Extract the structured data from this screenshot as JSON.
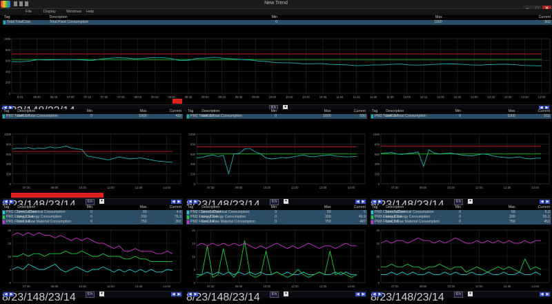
{
  "window": {
    "title": "New Trend",
    "menu": [
      "File",
      "Display",
      "Windows",
      "Help"
    ]
  },
  "headers": {
    "tag": "Tag",
    "desc": "Description",
    "min": "Min",
    "max": "Max",
    "cur": "Current"
  },
  "top": {
    "tag": "Total TotalCost",
    "desc": "Total Plant Consumption",
    "min": "0",
    "max": "1000",
    "cur": "502",
    "yticks": [
      "1000",
      "800",
      "600",
      "400",
      "200",
      "0"
    ],
    "xticks": [
      "6:15",
      "06:30",
      "06:45",
      "07:00",
      "07:15",
      "07:30",
      "07:45",
      "08:00",
      "08:15",
      "08:30",
      "08:45",
      "09:00",
      "09:15",
      "09:30",
      "09:45",
      "10:00",
      "10:15",
      "10:30",
      "10:45",
      "11:00",
      "11:15",
      "11:30",
      "11:45",
      "12:00",
      "12:15",
      "12:30",
      "12:45",
      "13:00",
      "13:15",
      "13:30",
      "13:45",
      "14:00"
    ],
    "date_left": "8/23/14",
    "date_right": "8/23/14",
    "interval": "8 h",
    "range": [
      0,
      1000
    ]
  },
  "mid": [
    {
      "tag": "PM1 TotalCost",
      "desc": "Line 1 Total Consumption",
      "min": "0",
      "max": "1000",
      "cur": "432",
      "yticks": [
        "1000",
        "800",
        "600",
        "400",
        "200",
        "0"
      ],
      "xticks": [
        "07:30",
        "09:00",
        "10:30",
        "12:00",
        "13:30",
        "14:00"
      ],
      "date_left": "8/23/14",
      "date_right": "8/23/14",
      "interval": "6 h",
      "range": [
        0,
        1000
      ]
    },
    {
      "tag": "PM2 TotalCost",
      "desc": "Line 2 Total Consumption",
      "min": "0",
      "max": "1000",
      "cur": "550",
      "yticks": [
        "1000",
        "800",
        "600",
        "400",
        "200",
        "0"
      ],
      "xticks": [
        "07:30",
        "09:00",
        "10:30",
        "12:00",
        "13:30",
        "14:00"
      ],
      "date_left": "8/23/14",
      "date_right": "8/23/14",
      "interval": "6 h",
      "range": [
        0,
        1000
      ]
    },
    {
      "tag": "PM3 TotalCost",
      "desc": "Line 3 Total Consumption",
      "min": "0",
      "max": "1000",
      "cur": "515",
      "yticks": [
        "1000",
        "800",
        "600",
        "400",
        "200",
        "0"
      ],
      "xticks": [
        "07:30",
        "09:00",
        "10:30",
        "12:00",
        "13:30",
        "14:00"
      ],
      "date_left": "8/23/14",
      "date_right": "8/23/14",
      "interval": "6 h",
      "range": [
        0,
        1000
      ]
    }
  ],
  "bottom": [
    {
      "rows": [
        {
          "tag": "PM1 ChemicalCost",
          "desc": "Line 1 Chemical Consumption",
          "min": "0",
          "max": "50",
          "cur": "4.6",
          "color": "#22cccc"
        },
        {
          "tag": "PM1 EnergyCost",
          "desc": "Line 1 Energy Consumption",
          "min": "0",
          "max": "200",
          "cur": "76.3",
          "color": "#22cc44"
        },
        {
          "tag": "PM1 FiberCost",
          "desc": "Line 1 Raw Material Consumption",
          "min": "0",
          "max": "750",
          "cur": "391",
          "color": "#cc33cc"
        }
      ],
      "yticks": [
        "20",
        "15",
        "10",
        "5",
        "0"
      ],
      "xticks": [
        "07:30",
        "09:00",
        "10:30",
        "12:00",
        "13:30",
        "14:00"
      ],
      "date_left": "8/23/14",
      "date_right": "8/23/14",
      "interval": "6 h"
    },
    {
      "rows": [
        {
          "tag": "PM2 ChemicalCost",
          "desc": "Line 2 Chemical Consumption",
          "min": "0",
          "max": "50",
          "cur": "5",
          "color": "#22cccc"
        },
        {
          "tag": "PM2 EnergyCost",
          "desc": "Line 2 Energy Consumption",
          "min": "0",
          "max": "200",
          "cur": "45.9",
          "color": "#22cc44"
        },
        {
          "tag": "PM2 FiberCost",
          "desc": "Line 2 Raw Material Consumption",
          "min": "0",
          "max": "750",
          "cur": "497",
          "color": "#cc33cc"
        }
      ],
      "yticks": [
        "20",
        "15",
        "10",
        "5",
        "0"
      ],
      "xticks": [
        "07:30",
        "09:00",
        "10:30",
        "12:00",
        "13:30",
        "14:00"
      ],
      "date_left": "8/23/14",
      "date_right": "8/23/14",
      "interval": "6 h"
    },
    {
      "rows": [
        {
          "tag": "PM3 ChemicalCost",
          "desc": "Line 3 Chemical Consumption",
          "min": "0",
          "max": "50",
          "cur": "6.3",
          "color": "#22cccc"
        },
        {
          "tag": "PM3 EnergyCost",
          "desc": "Line 3 Energy Consumption",
          "min": "0",
          "max": "200",
          "cur": "55.1",
          "color": "#22cc44"
        },
        {
          "tag": "PM3 FiberCost",
          "desc": "Line 3 Raw Material Consumption",
          "min": "0",
          "max": "750",
          "cur": "453",
          "color": "#cc33cc"
        }
      ],
      "yticks": [
        "20",
        "15",
        "10",
        "5",
        "0"
      ],
      "xticks": [
        "07:30",
        "09:00",
        "10:30",
        "12:00",
        "13:30",
        "14:00"
      ],
      "date_left": "8/23/14",
      "date_right": "8/23/14",
      "interval": "6 h"
    }
  ],
  "colors": {
    "trace": "#20b0b0",
    "limit_high": "#c82020",
    "limit_low": "#20c020",
    "alarm": "#e02020",
    "energy": "#22cc44",
    "fiber": "#cc33cc",
    "chem": "#22cccc"
  },
  "chart_data": [
    {
      "type": "line",
      "series": [
        {
          "name": "Total TotalCost",
          "values": [
            580,
            575,
            590,
            620,
            610,
            615,
            620,
            618,
            612,
            600,
            625,
            640,
            650,
            645,
            630,
            640,
            655,
            650,
            640,
            600,
            605,
            640,
            645,
            660,
            640,
            630,
            620,
            610,
            590,
            580,
            560,
            560,
            555,
            540,
            540,
            545,
            530,
            525,
            520,
            505,
            510,
            520,
            520,
            530,
            535,
            520,
            515,
            522,
            530,
            540,
            538,
            530,
            520,
            515,
            525,
            530,
            532,
            524,
            510,
            505,
            502
          ]
        }
      ],
      "ylim": [
        0,
        1000
      ],
      "limits": {
        "high": 720,
        "low": 620
      }
    },
    {
      "type": "line",
      "series": [
        {
          "name": "PM1 TotalCost",
          "values": [
            700,
            720,
            710,
            730,
            700,
            720,
            710,
            740,
            720,
            730,
            760,
            720,
            700,
            690,
            560,
            540,
            520,
            500,
            480,
            510,
            540,
            520,
            500,
            510,
            520,
            500,
            480,
            460,
            450,
            440,
            432
          ]
        }
      ],
      "ylim": [
        0,
        1000
      ],
      "limits": {
        "high": 650,
        "low": 0
      }
    },
    {
      "type": "line",
      "series": [
        {
          "name": "PM2 TotalCost",
          "values": [
            520,
            530,
            560,
            580,
            550,
            570,
            200,
            600,
            610,
            700,
            710,
            640,
            600,
            520,
            500,
            510,
            530,
            520,
            540,
            560,
            580,
            550,
            540,
            560,
            570,
            580,
            560,
            550,
            540,
            545,
            550
          ]
        }
      ],
      "ylim": [
        0,
        1000
      ],
      "limits": {
        "high": 740,
        "low": 600
      }
    },
    {
      "type": "line",
      "series": [
        {
          "name": "PM3 TotalCost",
          "values": [
            610,
            620,
            630,
            600,
            590,
            610,
            620,
            640,
            350,
            680,
            620,
            600,
            610,
            620,
            600,
            580,
            570,
            560,
            580,
            600,
            590,
            560,
            540,
            530,
            520,
            530,
            540,
            510,
            500,
            515,
            515
          ]
        }
      ],
      "ylim": [
        0,
        1000
      ],
      "limits": {
        "high": 760,
        "low": 600
      }
    },
    {
      "type": "line",
      "series": [
        {
          "name": "PM1 ChemicalCost",
          "values": [
            5,
            6,
            5,
            7,
            6,
            5,
            5,
            6,
            7,
            5,
            4,
            5,
            6,
            5,
            4,
            5,
            5,
            6,
            5,
            4,
            5,
            4,
            5,
            4,
            5,
            4,
            5,
            4,
            4,
            5,
            4.6
          ]
        },
        {
          "name": "PM1 EnergyCost",
          "values": [
            10,
            10,
            11,
            10,
            11,
            11,
            10,
            11,
            11,
            11,
            12,
            11,
            11,
            12,
            11,
            10,
            10,
            11,
            10,
            10,
            10,
            9,
            9,
            10,
            9,
            9,
            8,
            8,
            8,
            8,
            8
          ]
        },
        {
          "name": "PM1 FiberCost",
          "values": [
            18,
            19,
            18,
            19,
            18,
            19,
            18,
            18,
            17,
            18,
            17,
            16,
            17,
            16,
            17,
            16,
            15,
            15,
            14,
            13,
            14,
            12,
            12,
            13,
            12,
            12,
            12,
            11,
            11,
            12,
            11
          ]
        }
      ],
      "ylim": [
        0,
        20
      ]
    },
    {
      "type": "line",
      "series": [
        {
          "name": "PM2 ChemicalCost",
          "values": [
            3,
            3,
            4,
            3,
            4,
            3,
            4,
            3,
            4,
            3,
            4,
            3,
            4,
            3,
            3,
            4,
            3,
            4,
            3,
            3,
            4,
            3,
            3,
            4,
            3,
            3,
            4,
            3,
            4,
            3,
            3
          ]
        },
        {
          "name": "PM2 EnergyCost",
          "values": [
            2,
            3,
            14,
            2,
            3,
            13,
            4,
            2,
            5,
            16,
            3,
            2,
            3,
            12,
            3,
            4,
            3,
            2,
            3,
            5,
            3,
            2,
            3,
            4,
            3,
            12,
            3,
            4,
            3,
            2,
            3
          ]
        },
        {
          "name": "PM2 FiberCost",
          "values": [
            14,
            15,
            14,
            15,
            14,
            15,
            14,
            15,
            14,
            15,
            14,
            13,
            14,
            13,
            14,
            15,
            14,
            13,
            14,
            13,
            14,
            15,
            14,
            13,
            14,
            14,
            13,
            14,
            15,
            14,
            14
          ]
        }
      ],
      "ylim": [
        0,
        20
      ]
    },
    {
      "type": "line",
      "series": [
        {
          "name": "PM3 ChemicalCost",
          "values": [
            3,
            3,
            4,
            3,
            4,
            3,
            4,
            3,
            3,
            4,
            3,
            3,
            4,
            3,
            4,
            3,
            3,
            4,
            3,
            3,
            4,
            3,
            3,
            4,
            3,
            3,
            4,
            3,
            3,
            4,
            3
          ]
        },
        {
          "name": "PM3 EnergyCost",
          "values": [
            6,
            6,
            7,
            6,
            6,
            7,
            6,
            6,
            5,
            6,
            6,
            7,
            6,
            5,
            6,
            6,
            4,
            5,
            6,
            5,
            4,
            5,
            6,
            5,
            6,
            5,
            4,
            9,
            5,
            6,
            5
          ]
        },
        {
          "name": "PM3 FiberCost",
          "values": [
            15,
            16,
            15,
            16,
            16,
            15,
            16,
            17,
            16,
            16,
            15,
            16,
            15,
            16,
            17,
            16,
            15,
            15,
            16,
            15,
            16,
            15,
            16,
            15,
            16,
            15,
            15,
            16,
            15,
            16,
            16
          ]
        }
      ],
      "ylim": [
        0,
        20
      ]
    }
  ]
}
